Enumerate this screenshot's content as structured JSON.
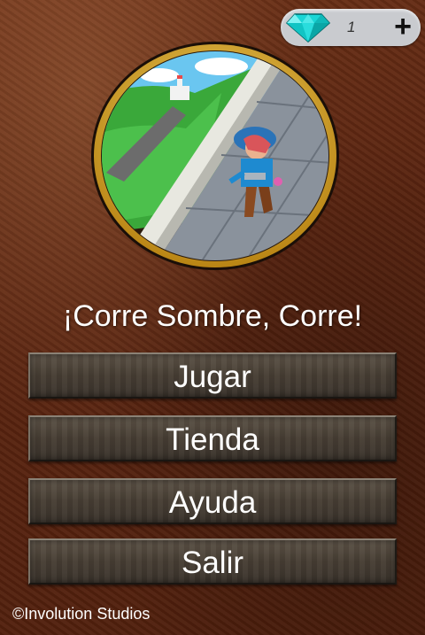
{
  "currency": {
    "gems": "1",
    "add_label": "+"
  },
  "title": "¡Corre Sombre, Corre!",
  "menu": [
    {
      "label": "Jugar"
    },
    {
      "label": "Tienda"
    },
    {
      "label": "Ayuda"
    },
    {
      "label": "Salir"
    }
  ],
  "footer": "©Involution Studios",
  "colors": {
    "frame_gold": "#e0b23a",
    "gem_cyan": "#19d6d6",
    "leather_bg": "#5a2410"
  }
}
